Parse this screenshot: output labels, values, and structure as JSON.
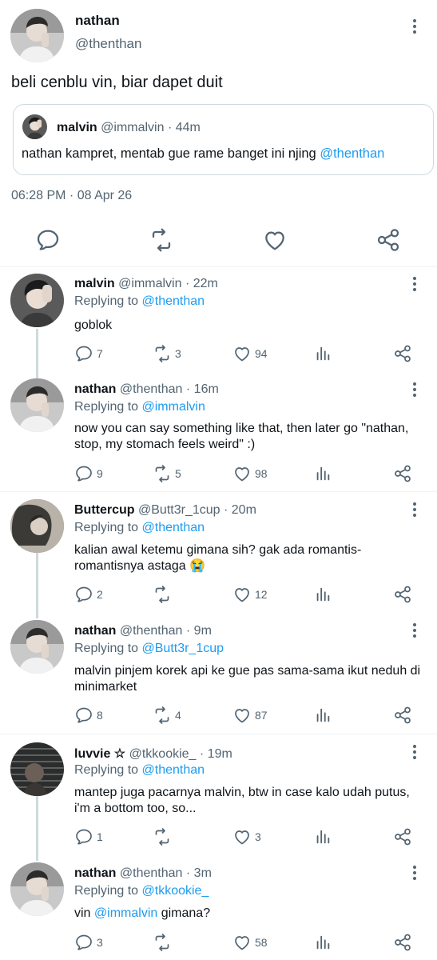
{
  "main": {
    "name": "nathan",
    "handle": "@thenthan",
    "text": "beli cenblu vin, biar dapet duit",
    "quote": {
      "name": "malvin",
      "handle": "@immalvin",
      "time": "· 44m",
      "text_prefix": "nathan kampret, mentab gue rame banget ini njing ",
      "mention": "@thenthan"
    },
    "timestamp": "06:28 PM · 08 Apr 26"
  },
  "replying_prefix": "Replying to",
  "replies": [
    {
      "name": "malvin",
      "handle": "@immalvin",
      "time": "· 22m",
      "replying_to": "@thenthan",
      "text": "goblok",
      "replies": "7",
      "retweets": "3",
      "likes": "94"
    },
    {
      "name": "nathan",
      "handle": "@thenthan",
      "time": "· 16m",
      "replying_to": "@immalvin",
      "text": "now you can say something like that, then later go \"nathan, stop, my stomach feels weird\" :)",
      "replies": "9",
      "retweets": "5",
      "likes": "98"
    },
    {
      "name": "Buttercup",
      "handle": "@Butt3r_1cup",
      "time": "· 20m",
      "replying_to": "@thenthan",
      "text": "kalian awal ketemu gimana sih? gak ada romantis-romantisnya astaga 😭",
      "replies": "2",
      "retweets": "",
      "likes": "12"
    },
    {
      "name": "nathan",
      "handle": "@thenthan",
      "time": "· 9m",
      "replying_to": "@Butt3r_1cup",
      "text": "malvin pinjem korek api ke gue pas sama-sama ikut neduh di minimarket",
      "replies": "8",
      "retweets": "4",
      "likes": "87"
    },
    {
      "name": "luvvie ☆",
      "handle": "@tkkookie_",
      "time": "· 19m",
      "replying_to": "@thenthan",
      "text": "mantep juga pacarnya malvin, btw in case kalo udah putus, i'm a bottom too, so...",
      "replies": "1",
      "retweets": "",
      "likes": "3"
    },
    {
      "name": "nathan",
      "handle": "@thenthan",
      "time": "· 3m",
      "replying_to": "@tkkookie_",
      "text_prefix": "vin ",
      "text_mention": "@immalvin",
      "text_suffix": " gimana?",
      "replies": "3",
      "retweets": "",
      "likes": "58"
    }
  ],
  "icons": {
    "reply": "reply-icon",
    "retweet": "retweet-icon",
    "like": "heart-icon",
    "views": "views-icon",
    "share": "share-icon",
    "more": "more-icon"
  },
  "colors": {
    "text": "#0f1419",
    "secondary": "#536471",
    "link": "#1d9bf0",
    "divider": "#eff3f4",
    "thread_line": "#cfd9de"
  }
}
